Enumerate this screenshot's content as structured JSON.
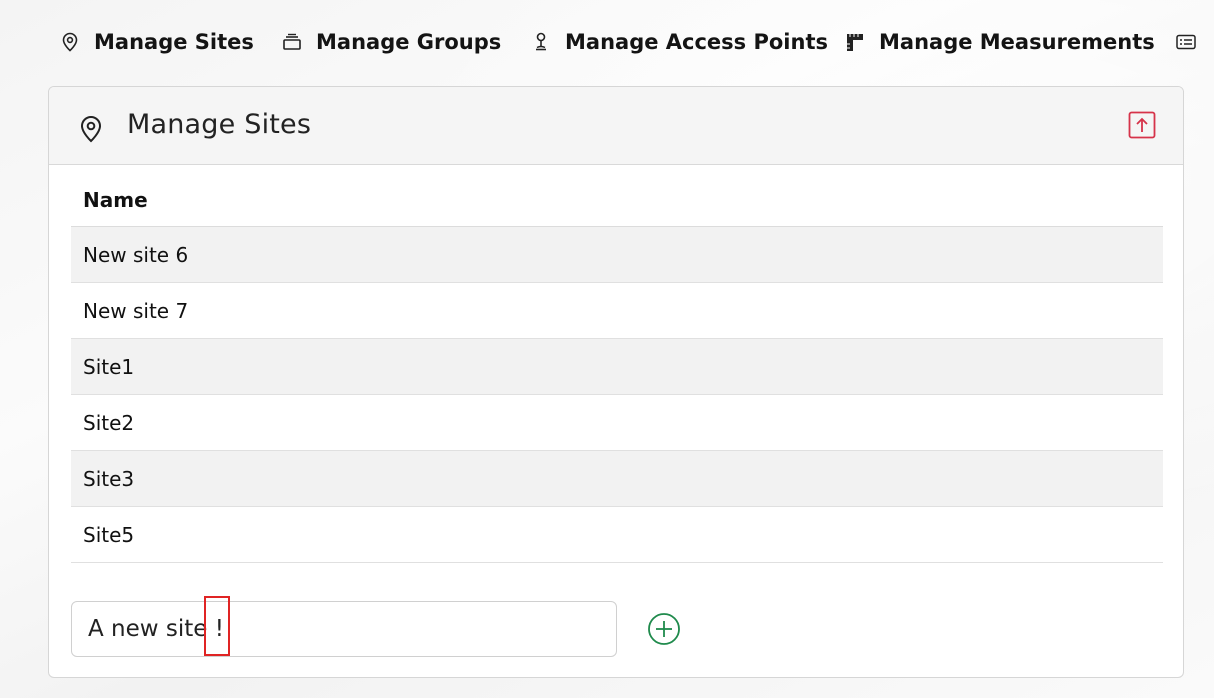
{
  "nav": {
    "items": [
      {
        "label": "Manage Sites",
        "icon": "map-pin-icon"
      },
      {
        "label": "Manage Groups",
        "icon": "layers-icon"
      },
      {
        "label": "Manage Access Points",
        "icon": "access-point-icon"
      },
      {
        "label": "Manage Measurements",
        "icon": "ruler-icon"
      },
      {
        "label": "",
        "icon": "id-card-icon"
      }
    ]
  },
  "panel": {
    "title": "Manage Sites",
    "title_icon": "map-pin-icon",
    "collapse_icon": "arrow-up-box-icon",
    "table": {
      "header": "Name",
      "rows": [
        "New site 6",
        "New site 7",
        "Site1",
        "Site2",
        "Site3",
        "Site5"
      ]
    },
    "new_site": {
      "value": "A new site !",
      "placeholder": ""
    },
    "add_icon": "plus-circle-icon"
  },
  "colors": {
    "accent_red": "#d6334a",
    "add_green": "#1f8a4c",
    "row_shade": "#f2f2f2",
    "highlight": "#e02424"
  }
}
